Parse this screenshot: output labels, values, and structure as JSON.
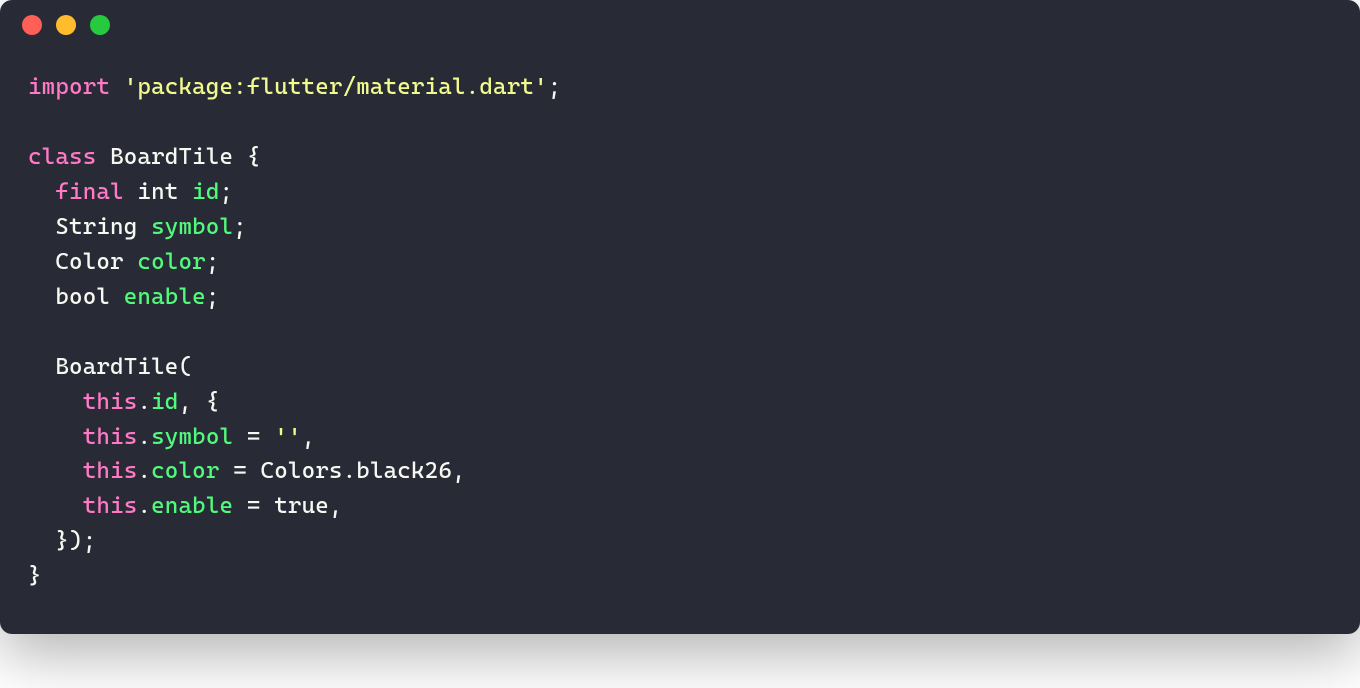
{
  "titlebar": {
    "close": {
      "name": "close",
      "color": "#ff5f56"
    },
    "minimize": {
      "name": "minimize",
      "color": "#ffbd2e"
    },
    "zoom": {
      "name": "zoom",
      "color": "#27c93f"
    }
  },
  "code": {
    "language": "dart",
    "tokens": [
      [
        {
          "t": "import ",
          "c": "keyword"
        },
        {
          "t": "'package:flutter/material.dart'",
          "c": "string"
        },
        {
          "t": ";",
          "c": "punct"
        }
      ],
      [],
      [
        {
          "t": "class ",
          "c": "keyword"
        },
        {
          "t": "BoardTile ",
          "c": "type"
        },
        {
          "t": "{",
          "c": "punct"
        }
      ],
      [
        {
          "t": "  ",
          "c": "punct"
        },
        {
          "t": "final ",
          "c": "keyword"
        },
        {
          "t": "int ",
          "c": "type"
        },
        {
          "t": "id",
          "c": "ident"
        },
        {
          "t": ";",
          "c": "punct"
        }
      ],
      [
        {
          "t": "  String ",
          "c": "type"
        },
        {
          "t": "symbol",
          "c": "ident"
        },
        {
          "t": ";",
          "c": "punct"
        }
      ],
      [
        {
          "t": "  Color ",
          "c": "type"
        },
        {
          "t": "color",
          "c": "ident"
        },
        {
          "t": ";",
          "c": "punct"
        }
      ],
      [
        {
          "t": "  bool ",
          "c": "type"
        },
        {
          "t": "enable",
          "c": "ident"
        },
        {
          "t": ";",
          "c": "punct"
        }
      ],
      [],
      [
        {
          "t": "  BoardTile(",
          "c": "type"
        }
      ],
      [
        {
          "t": "    ",
          "c": "punct"
        },
        {
          "t": "this",
          "c": "keyword"
        },
        {
          "t": ".",
          "c": "punct"
        },
        {
          "t": "id",
          "c": "ident"
        },
        {
          "t": ", {",
          "c": "punct"
        }
      ],
      [
        {
          "t": "    ",
          "c": "punct"
        },
        {
          "t": "this",
          "c": "keyword"
        },
        {
          "t": ".",
          "c": "punct"
        },
        {
          "t": "symbol",
          "c": "ident"
        },
        {
          "t": " = ",
          "c": "punct"
        },
        {
          "t": "''",
          "c": "string"
        },
        {
          "t": ",",
          "c": "punct"
        }
      ],
      [
        {
          "t": "    ",
          "c": "punct"
        },
        {
          "t": "this",
          "c": "keyword"
        },
        {
          "t": ".",
          "c": "punct"
        },
        {
          "t": "color",
          "c": "ident"
        },
        {
          "t": " = Colors.black26,",
          "c": "punct"
        }
      ],
      [
        {
          "t": "    ",
          "c": "punct"
        },
        {
          "t": "this",
          "c": "keyword"
        },
        {
          "t": ".",
          "c": "punct"
        },
        {
          "t": "enable",
          "c": "ident"
        },
        {
          "t": " = true,",
          "c": "punct"
        }
      ],
      [
        {
          "t": "  });",
          "c": "punct"
        }
      ],
      [
        {
          "t": "}",
          "c": "punct"
        }
      ]
    ]
  }
}
